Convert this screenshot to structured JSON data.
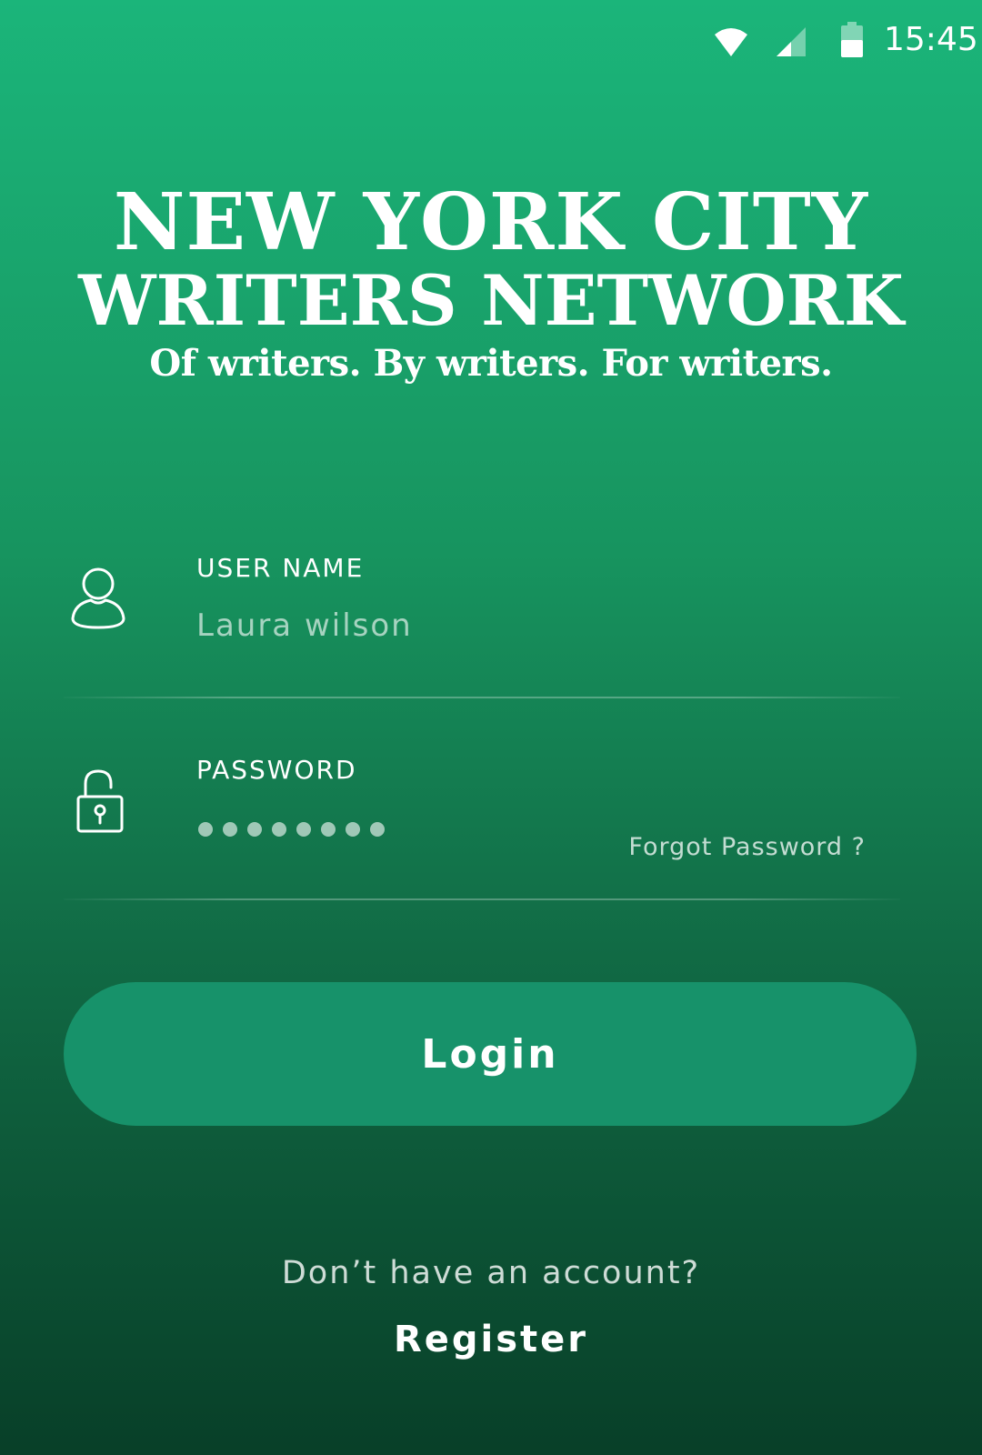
{
  "status_bar": {
    "time": "15:45",
    "icons": [
      "wifi-icon",
      "cellular-signal-icon",
      "battery-icon"
    ]
  },
  "logo": {
    "line1": "NEW YORK CITY",
    "line2": "WRITERS NETWORK",
    "tagline": "Of writers. By writers. For writers."
  },
  "form": {
    "username": {
      "icon": "user-icon",
      "label": "USER NAME",
      "value": "Laura wilson"
    },
    "password": {
      "icon": "lock-icon",
      "label": "PASSWORD",
      "masked_length": 8,
      "forgot_label": "Forgot Password ?"
    }
  },
  "login_label": "Login",
  "register": {
    "prompt": "Don’t have an account?",
    "link_label": "Register"
  },
  "colors": {
    "gradient_top": "#1bb57a",
    "gradient_bottom": "#083f28",
    "button": "#17926a",
    "text": "#ffffff"
  }
}
